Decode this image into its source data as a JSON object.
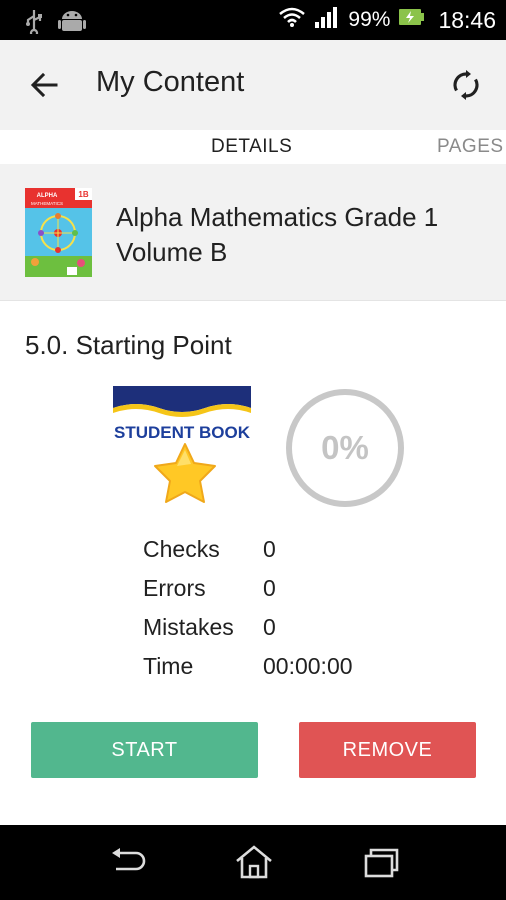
{
  "status_bar": {
    "battery": "99%",
    "time": "18:46",
    "icons": [
      "usb-icon",
      "android-icon",
      "wifi-icon",
      "signal-icon",
      "battery-charging-icon"
    ]
  },
  "app_bar": {
    "title": "My Content",
    "back_icon": "arrow-back-icon",
    "sync_icon": "sync-icon"
  },
  "tabs": [
    {
      "label": "DETAILS",
      "active": true
    },
    {
      "label": "PAGES",
      "active": false
    }
  ],
  "book": {
    "title": "Alpha Mathematics Grade 1 Volume B",
    "cover": {
      "brand": "ALPHA",
      "subtitle": "MATHEMATICS",
      "grade": "1B"
    }
  },
  "section": {
    "title": "5.0. Starting Point",
    "badge_text": "STUDENT BOOK",
    "progress": {
      "value": 0,
      "label": "0%"
    }
  },
  "stats": [
    {
      "label": "Checks",
      "value": "0"
    },
    {
      "label": "Errors",
      "value": "0"
    },
    {
      "label": "Mistakes",
      "value": "0"
    },
    {
      "label": "Time",
      "value": "00:00:00"
    }
  ],
  "actions": {
    "start_label": "START",
    "remove_label": "REMOVE",
    "start_color": "#52b78e",
    "remove_color": "#e05454"
  },
  "nav_bar": {
    "icons": [
      "back-nav-icon",
      "home-icon",
      "recent-apps-icon"
    ]
  }
}
